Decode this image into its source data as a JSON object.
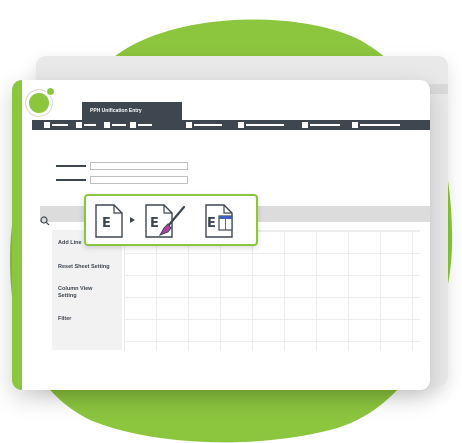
{
  "colors": {
    "accent": "#8cc63f",
    "dark": "#3e4650",
    "brush": "#b03fa3"
  },
  "header": {
    "title": "PPH Unification Entry"
  },
  "icons": {
    "logo": "brand-logo-icon",
    "search": "search-icon",
    "doc_plain": "document-e-icon",
    "doc_format": "document-e-paintbrush-icon",
    "doc_columns": "document-e-columns-icon",
    "arrow": "arrow-right-icon"
  },
  "side_menu": {
    "items": [
      {
        "label": "Add Line"
      },
      {
        "label": "Reset Sheet Setting"
      },
      {
        "label": "Column View\nSetting"
      },
      {
        "label": "Filter"
      }
    ]
  },
  "popup": {
    "doc_letter": "E"
  }
}
